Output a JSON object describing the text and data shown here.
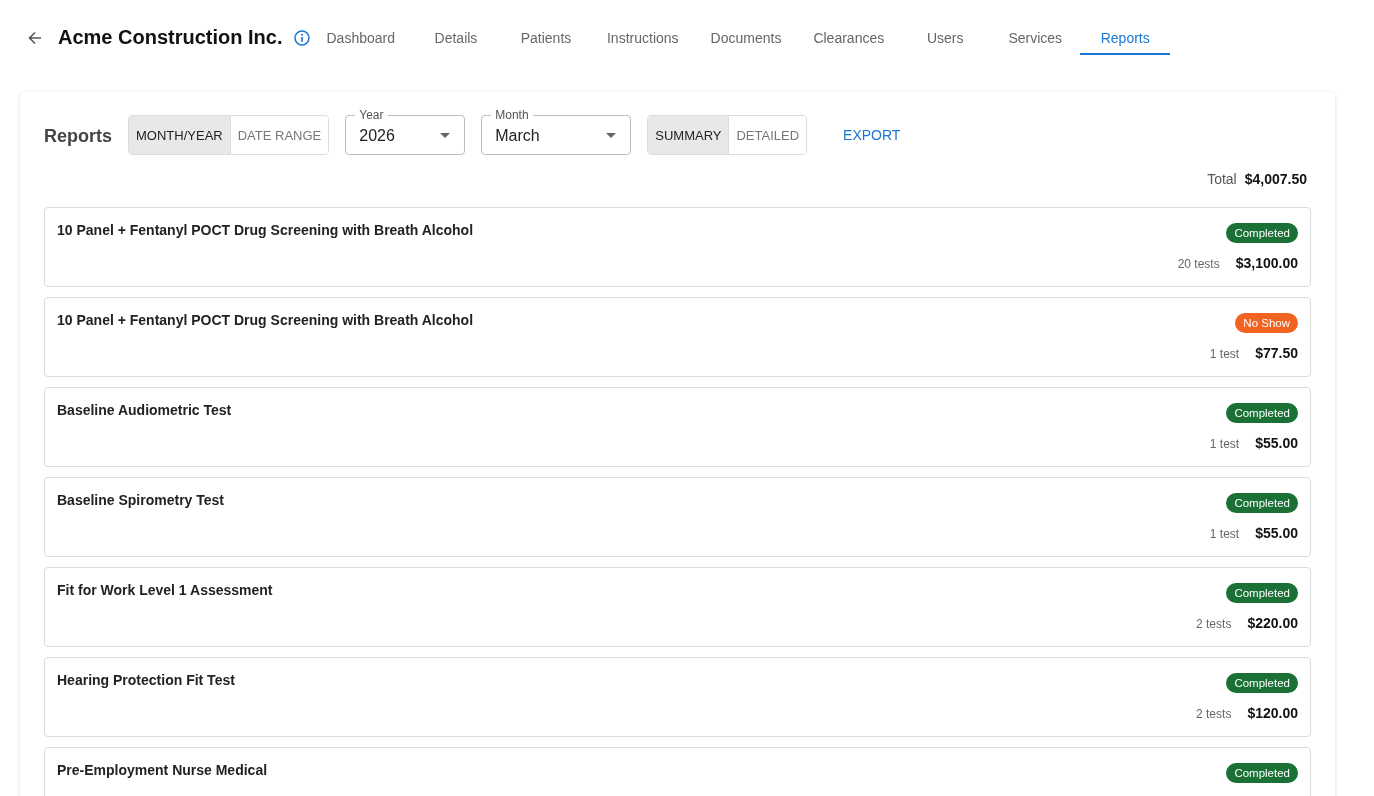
{
  "header": {
    "title": "Acme Construction Inc.",
    "tabs": [
      {
        "label": "Dashboard",
        "selected": false
      },
      {
        "label": "Details",
        "selected": false
      },
      {
        "label": "Patients",
        "selected": false
      },
      {
        "label": "Instructions",
        "selected": false
      },
      {
        "label": "Documents",
        "selected": false
      },
      {
        "label": "Clearances",
        "selected": false
      },
      {
        "label": "Users",
        "selected": false
      },
      {
        "label": "Services",
        "selected": false
      },
      {
        "label": "Reports",
        "selected": true
      }
    ]
  },
  "reports": {
    "heading": "Reports",
    "period_mode": [
      {
        "label": "MONTH/YEAR",
        "selected": true
      },
      {
        "label": "DATE RANGE",
        "selected": false
      }
    ],
    "selects": [
      {
        "label": "Year",
        "value": "2026",
        "kind": "year"
      },
      {
        "label": "Month",
        "value": "March",
        "kind": "month"
      }
    ],
    "view_mode": [
      {
        "label": "SUMMARY",
        "selected": true
      },
      {
        "label": "DETAILED",
        "selected": false
      }
    ],
    "export_button": "EXPORT",
    "total": {
      "label": "Total",
      "amount": "$4,007.50"
    },
    "services": [
      {
        "name": "10 Panel + Fentanyl POCT Drug Screening with Breath Alcohol",
        "status": "Completed",
        "color": "#1a7035",
        "tests": "20 tests",
        "amount": "$3,100.00"
      },
      {
        "name": "10 Panel + Fentanyl POCT Drug Screening with Breath Alcohol",
        "status": "No Show",
        "color": "#f26322",
        "tests": "1 test",
        "amount": "$77.50"
      },
      {
        "name": "Baseline Audiometric Test",
        "status": "Completed",
        "color": "#1a7035",
        "tests": "1 test",
        "amount": "$55.00"
      },
      {
        "name": "Baseline Spirometry Test",
        "status": "Completed",
        "color": "#1a7035",
        "tests": "1 test",
        "amount": "$55.00"
      },
      {
        "name": "Fit for Work Level 1 Assessment",
        "status": "Completed",
        "color": "#1a7035",
        "tests": "2 tests",
        "amount": "$220.00"
      },
      {
        "name": "Hearing Protection Fit Test",
        "status": "Completed",
        "color": "#1a7035",
        "tests": "2 tests",
        "amount": "$120.00"
      },
      {
        "name": "Pre-Employment Nurse Medical",
        "status": "Completed",
        "color": "#1a7035"
      }
    ]
  }
}
